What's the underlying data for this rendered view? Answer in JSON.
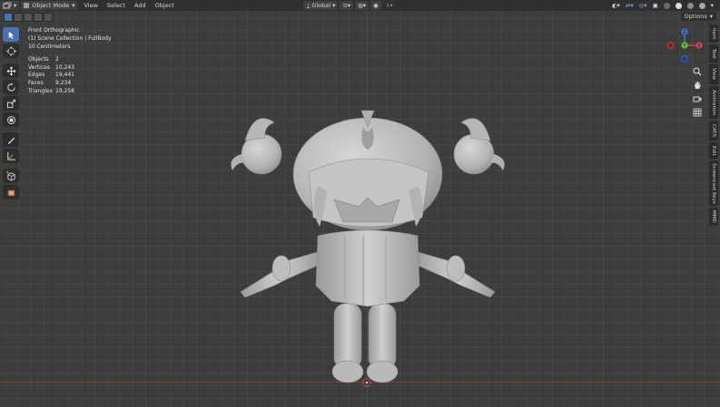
{
  "header": {
    "mode_label": "Object Mode",
    "menus": [
      "View",
      "Select",
      "Add",
      "Object"
    ],
    "orientation_label": "Global"
  },
  "toolbar_header": {
    "options_label": "Options"
  },
  "overlay": {
    "view_name": "Front Orthographic",
    "collection": "(1) Scene Collection | FullBody",
    "scale": "10 Centimeters",
    "stats": [
      {
        "label": "Objects",
        "value": "2"
      },
      {
        "label": "Vertices",
        "value": "10,243"
      },
      {
        "label": "Edges",
        "value": "19,441"
      },
      {
        "label": "Faces",
        "value": "9,234"
      },
      {
        "label": "Triangles",
        "value": "19,258"
      }
    ]
  },
  "gizmo": {
    "x": "X",
    "y": "Y",
    "z": "Z"
  },
  "sidebar_tabs": [
    "Item",
    "Tool",
    "View",
    "Animation",
    "CATS",
    "Edit",
    "Screencast Keys",
    "MMD"
  ],
  "tools": [
    "select-box-icon",
    "cursor-icon",
    "move-icon",
    "rotate-icon",
    "scale-icon",
    "transform-icon",
    "annotate-icon",
    "measure-icon",
    "add-cube-icon",
    "add-object-icon"
  ],
  "colors": {
    "accent": "#4772b3",
    "x_axis": "#e8404d",
    "y_axis": "#6bbf2f",
    "z_axis": "#3a76e8",
    "mesh": "#bdbdbd"
  }
}
